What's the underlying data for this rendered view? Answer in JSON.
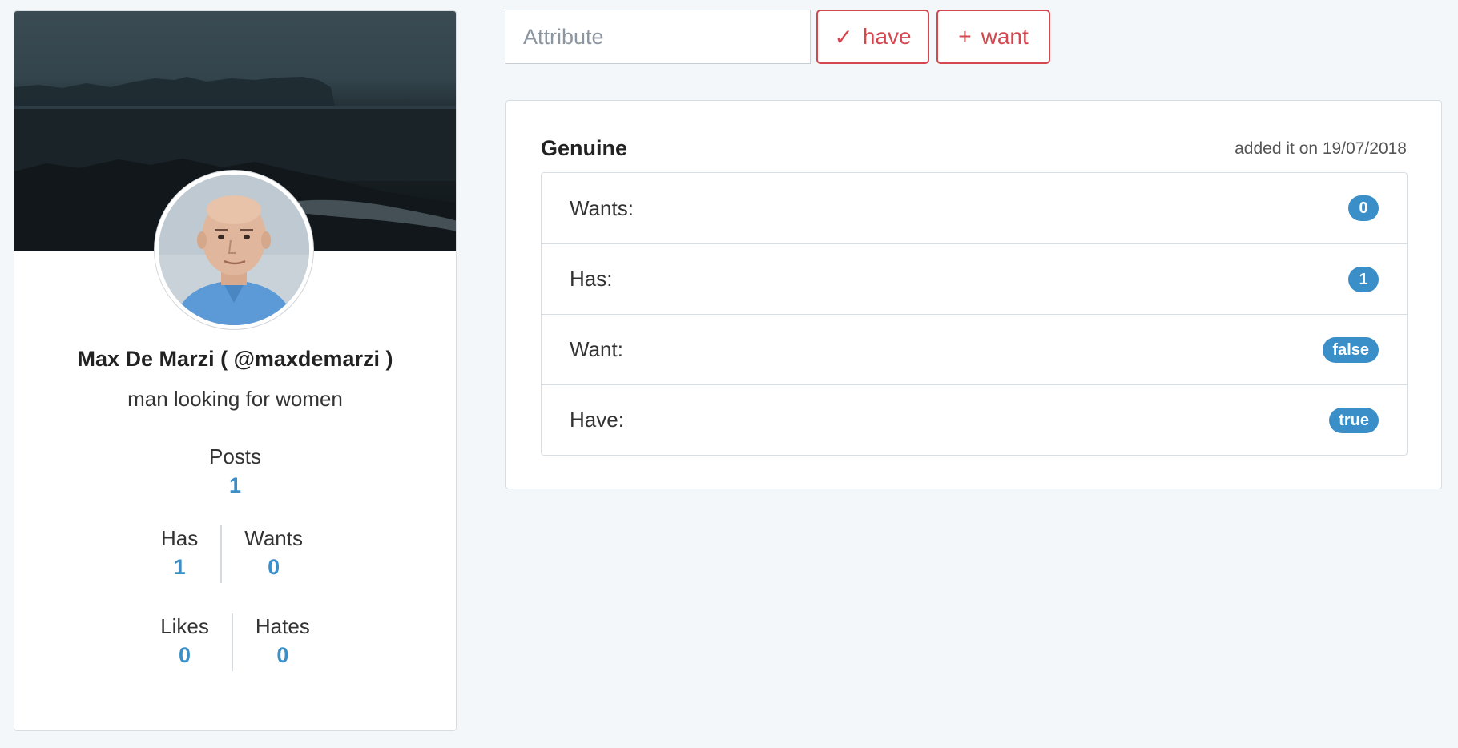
{
  "attribute_form": {
    "placeholder": "Attribute",
    "have_icon": "✓",
    "have_label": "have",
    "want_icon": "+",
    "want_label": "want"
  },
  "profile": {
    "name": "Max De Marzi ( @maxdemarzi )",
    "tagline": "man looking for women",
    "stats": {
      "posts_label": "Posts",
      "posts_value": "1",
      "has_label": "Has",
      "has_value": "1",
      "wants_label": "Wants",
      "wants_value": "0",
      "likes_label": "Likes",
      "likes_value": "0",
      "hates_label": "Hates",
      "hates_value": "0"
    }
  },
  "attribute_card": {
    "title": "Genuine",
    "date_text": "added it on 19/07/2018",
    "items": [
      {
        "label": "Wants:",
        "value": "0"
      },
      {
        "label": "Has:",
        "value": "1"
      },
      {
        "label": "Want:",
        "value": "false"
      },
      {
        "label": "Have:",
        "value": "true"
      }
    ]
  },
  "colors": {
    "accent_blue": "#3b8fc8",
    "button_red": "#d4474f",
    "page_bg": "#f4f7fa"
  }
}
